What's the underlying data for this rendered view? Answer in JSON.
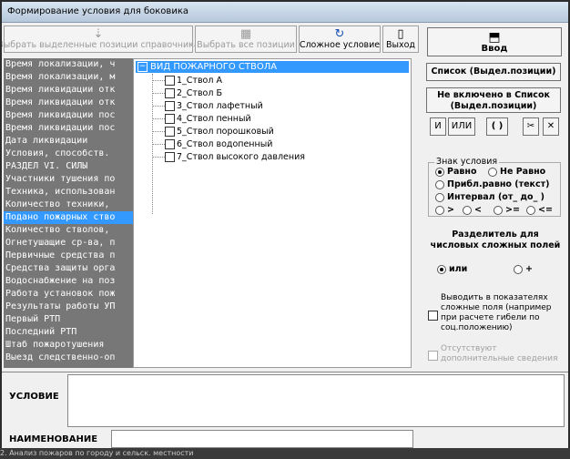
{
  "window": {
    "title": "Формирование условия для боковика"
  },
  "toolbar": {
    "select_ref": "Выбрать выделенные позиции справочника",
    "select_all": "Выбрать все позиции",
    "complex": "Сложное условие",
    "exit": "Выход",
    "enter": "Ввод"
  },
  "left_list": {
    "items": [
      "Время локализации, ч",
      "Время локализации, м",
      "Время ликвидации отк",
      "Время ликвидации отк",
      "Время ликвидации пос",
      "Время ликвидации пос",
      "Дата ликвидации",
      "Условия, способств.",
      "    РАЗДЕЛ VI. СИЛЫ",
      "Участники тушения по",
      "Техника, использован",
      "Количество техники,",
      "Подано пожарных ство",
      "Количество стволов,",
      "Огнетушащие ср-ва, п",
      "Первичные средства п",
      "Средства защиты орга",
      "Водоснабжение на поз",
      "Работа установок пож",
      "Результаты работы УП",
      "Первый РТП",
      "Последний РТП",
      "Штаб пожаротушения",
      "Выезд следственно-оп"
    ],
    "selected_index": 12
  },
  "tree": {
    "root": "ВИД ПОЖАРНОГО СТВОЛА",
    "expander": "−",
    "items": [
      "1_Ствол А",
      "2_Ствол Б",
      "3_Ствол лафетный",
      "4_Ствол пенный",
      "5_Ствол порошковый",
      "6_Ствол водопенный",
      "7_Ствол высокого давления"
    ]
  },
  "right": {
    "list_btn": "Список  (Выдел.позиции)",
    "not_list_btn_1": "Не включено в Список",
    "not_list_btn_2": "(Выдел.позиции)",
    "and": "И",
    "or": "ИЛИ",
    "paren": "( )",
    "scissors": "✂",
    "close": "✕",
    "sign_legend": "Знак условия",
    "sign_eq": "Равно",
    "sign_neq": "Не Равно",
    "sign_approx": "Прибл.равно (текст)",
    "sign_interval": "Интервал (от_ до_ )",
    "sign_gt": ">",
    "sign_lt": "<",
    "sign_ge": ">=",
    "sign_le": "<=",
    "sep_label": "Разделитель для числовых сложных полей",
    "sep_or": "или",
    "sep_plus": "+",
    "output_complex": "Выводить в показателях сложные поля (например при расчете гибели по соц.положению)",
    "missing_info": "Отсутствуют дополнительные сведения"
  },
  "bottom": {
    "condition_label": "УСЛОВИЕ",
    "condition_value": "",
    "name_label": "НАИМЕНОВАНИЕ",
    "name_value": ""
  },
  "status": {
    "text": "2. Анализ пожаров по городу и сельск. местности"
  }
}
